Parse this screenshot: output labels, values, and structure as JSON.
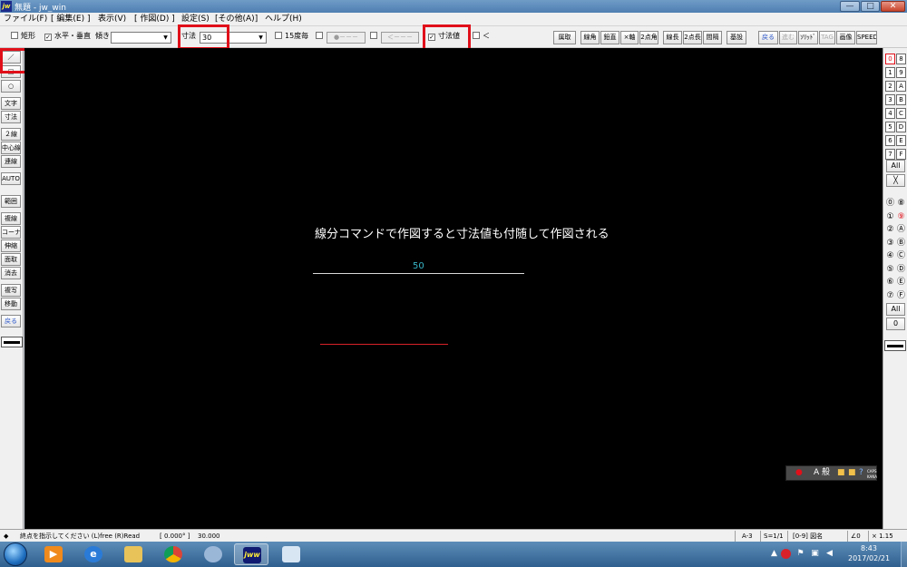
{
  "window": {
    "app_icon_text": "jw",
    "title": "無題 - jw_win",
    "minimize": "—",
    "maximize": "□",
    "close": "✕"
  },
  "menu": [
    "ファイル(F)",
    "[ 編集(E) ]",
    "表示(V)",
    "[ 作図(D) ]",
    "設定(S)",
    "[その他(A)]",
    "ヘルプ(H)"
  ],
  "toolbar": {
    "rect_label": "矩形",
    "horiz_vert_label": "水平・垂直",
    "angle_label": "傾き",
    "angle_value": "",
    "dim_label": "寸法",
    "dim_value": "30",
    "deg15_label": "15度毎",
    "point_style": "●－－－",
    "arrow_style": "＜－－－",
    "dim_value_label": "寸法値",
    "lt_label": "＜",
    "buttons": [
      "属取",
      "線角",
      "鉛直",
      "×軸",
      "2点角",
      "線長",
      "2点長",
      "間隔",
      "基設"
    ],
    "right_buttons": [
      "戻る",
      "進む",
      "ｿﾘｯﾄﾞ",
      "TAG",
      "画像",
      "SPEED"
    ],
    "checks": {
      "rect": false,
      "horiz_vert": true,
      "deg15": false,
      "point": false,
      "arrow": false,
      "dim_value": true,
      "lt": false
    }
  },
  "left_tools": [
    "／",
    "□",
    "○",
    "文字",
    "寸法",
    "２線",
    "中心線",
    "連線",
    "AUTO",
    "範囲",
    "複線",
    "コーナー",
    "伸縮",
    "面取",
    "消去",
    "複写",
    "移動",
    "戻る"
  ],
  "layers": {
    "group_cells": [
      [
        "0",
        "8"
      ],
      [
        "1",
        "9"
      ],
      [
        "2",
        "A"
      ],
      [
        "3",
        "B"
      ],
      [
        "4",
        "C"
      ],
      [
        "5",
        "D"
      ],
      [
        "6",
        "E"
      ],
      [
        "7",
        "F"
      ]
    ],
    "group_all": "All",
    "group_x": "╳",
    "layer_cells": [
      [
        "⓪",
        "⑧"
      ],
      [
        "①",
        "⑨"
      ],
      [
        "②",
        "Ⓐ"
      ],
      [
        "③",
        "Ⓑ"
      ],
      [
        "④",
        "Ⓒ"
      ],
      [
        "⑤",
        "Ⓓ"
      ],
      [
        "⑥",
        "Ⓔ"
      ],
      [
        "⑦",
        "Ⓕ"
      ]
    ],
    "layer_all": "All",
    "layer_zero": "0"
  },
  "canvas": {
    "message": "線分コマンドで作図すると寸法値も付随して作図される",
    "dimension_value": "50"
  },
  "ime": {
    "mode": "A 般",
    "caps": "CAPS",
    "kana": "KANA"
  },
  "status": {
    "message": "終点を指示してください (L)free (R)Read",
    "angle": "[ 0.000° ]",
    "length": "30.000",
    "paper": "A-3",
    "scale": "S=1/1",
    "layer": "[0-9] 図名",
    "rotation": "∠0",
    "zoom": "× 1.15"
  },
  "taskbar": {
    "clock_time": "8:43",
    "clock_date": "2017/02/21",
    "jw_label": "jww"
  },
  "colors": {
    "canvas_bg": "#000000",
    "dimension_text": "#38b6c8",
    "highlight_box": "#e0101a",
    "red_line": "#d8212a"
  }
}
